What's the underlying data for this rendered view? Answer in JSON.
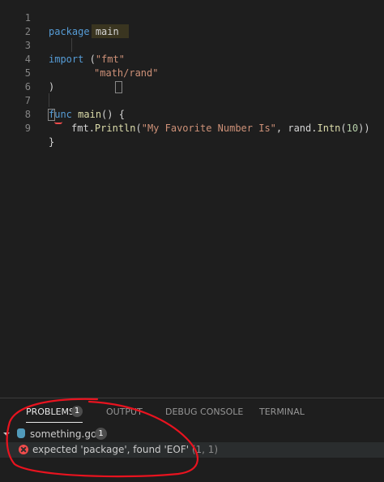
{
  "editor": {
    "line_numbers": [
      "1",
      "2",
      "3",
      "4",
      "5",
      "6",
      "7",
      "8",
      "9"
    ],
    "line1": {
      "kw": "package",
      "name": "main"
    },
    "line3": {
      "kw": "import",
      "paren": "(",
      "str": "\"fmt\""
    },
    "line4": {
      "str": "\"math/rand\""
    },
    "line5": {
      "paren": ")"
    },
    "line7": {
      "kw": "func",
      "fn": "main",
      "parens": "()",
      "brace": "{"
    },
    "line8": {
      "pkg": "fmt",
      "dot": ".",
      "fn": "Println",
      "open": "(",
      "str": "\"My Favorite Number Is\"",
      "comma": ", ",
      "pkg2": "rand",
      "dot2": ".",
      "fn2": "Intn",
      "open2": "(",
      "num": "10",
      "close": "))"
    },
    "line9": {
      "brace": "}"
    }
  },
  "panel": {
    "tabs": {
      "problems": "PROBLEMS",
      "problems_count": "1",
      "output": "OUTPUT",
      "debug_console": "DEBUG CONSOLE",
      "terminal": "TERMINAL"
    },
    "file": {
      "icon": "go-file-icon",
      "name": "something.go",
      "count": "1"
    },
    "error": {
      "icon": "error-icon",
      "message": "expected 'package', found 'EOF'",
      "location": "(1, 1)"
    }
  },
  "colors": {
    "keyword": "#569cd6",
    "string": "#ce9178",
    "function": "#dcdcaa",
    "error": "#f14c4c",
    "annotation": "#e8131f"
  }
}
